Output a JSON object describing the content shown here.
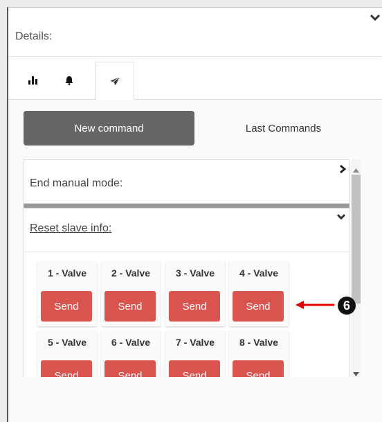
{
  "panel": {
    "title": "Details:"
  },
  "tabs": [
    {
      "icon": "bar-chart-icon"
    },
    {
      "icon": "bell-icon"
    },
    {
      "icon": "paper-plane-icon",
      "active": true
    }
  ],
  "segmented": {
    "active_label": "New command",
    "inactive_label": "Last Commands"
  },
  "commands": {
    "end_manual": {
      "label": "End manual mode:"
    },
    "reset_slave": {
      "label": "Reset slave info:"
    },
    "valves": [
      {
        "name": "1 - Valve",
        "button": "Send"
      },
      {
        "name": "2 - Valve",
        "button": "Send"
      },
      {
        "name": "3 - Valve",
        "button": "Send"
      },
      {
        "name": "4 - Valve",
        "button": "Send"
      },
      {
        "name": "5 - Valve",
        "button": "Send"
      },
      {
        "name": "6 - Valve",
        "button": "Send"
      },
      {
        "name": "7 - Valve",
        "button": "Send"
      },
      {
        "name": "8 - Valve",
        "button": "Send"
      }
    ]
  },
  "annotation": {
    "number": "6",
    "color": "#e00000"
  },
  "colors": {
    "send_button": "#d9534f",
    "active_segment": "#666666"
  }
}
